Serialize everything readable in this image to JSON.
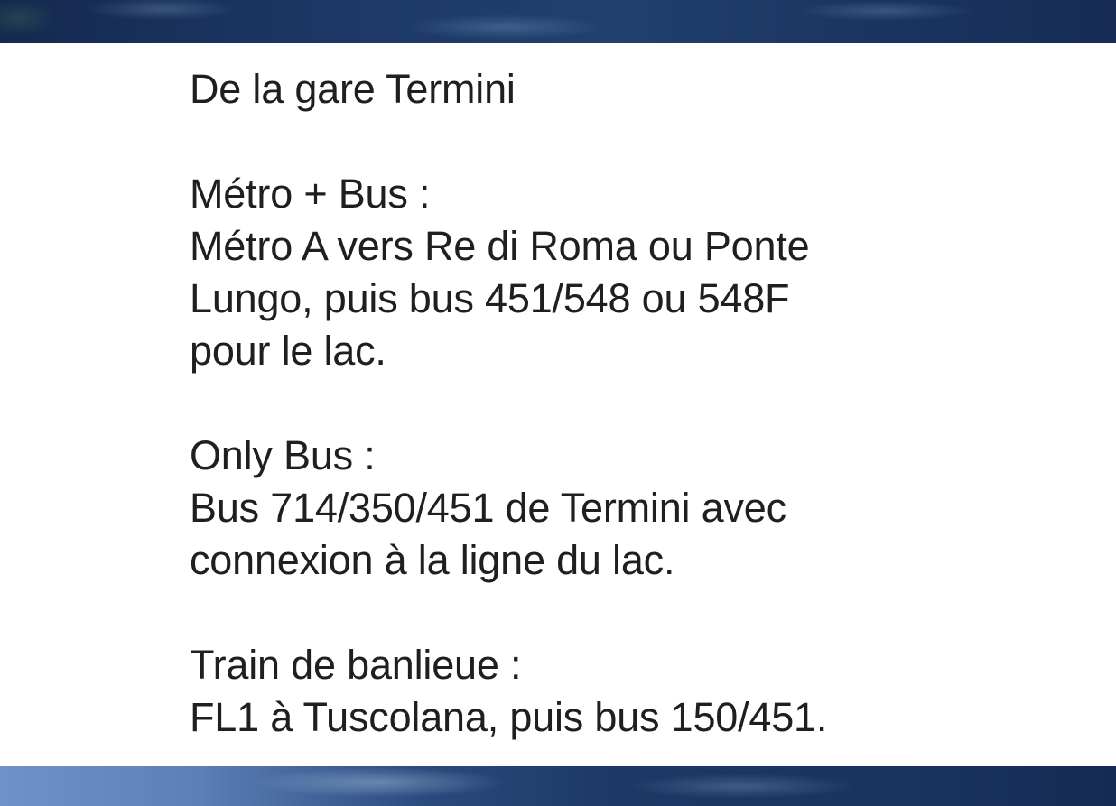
{
  "heading": "De la gare Termini",
  "sections": [
    {
      "title": "Métro + Bus :",
      "lines": [
        "Métro A vers Re di Roma ou Ponte",
        "Lungo, puis bus 451/548 ou 548F",
        "pour le lac."
      ]
    },
    {
      "title": "Only Bus :",
      "lines": [
        "Bus 714/350/451 de Termini avec",
        "connexion à la ligne du lac."
      ]
    },
    {
      "title": "Train de banlieue :",
      "lines": [
        "FL1 à Tuscolana, puis bus 150/451."
      ]
    }
  ]
}
